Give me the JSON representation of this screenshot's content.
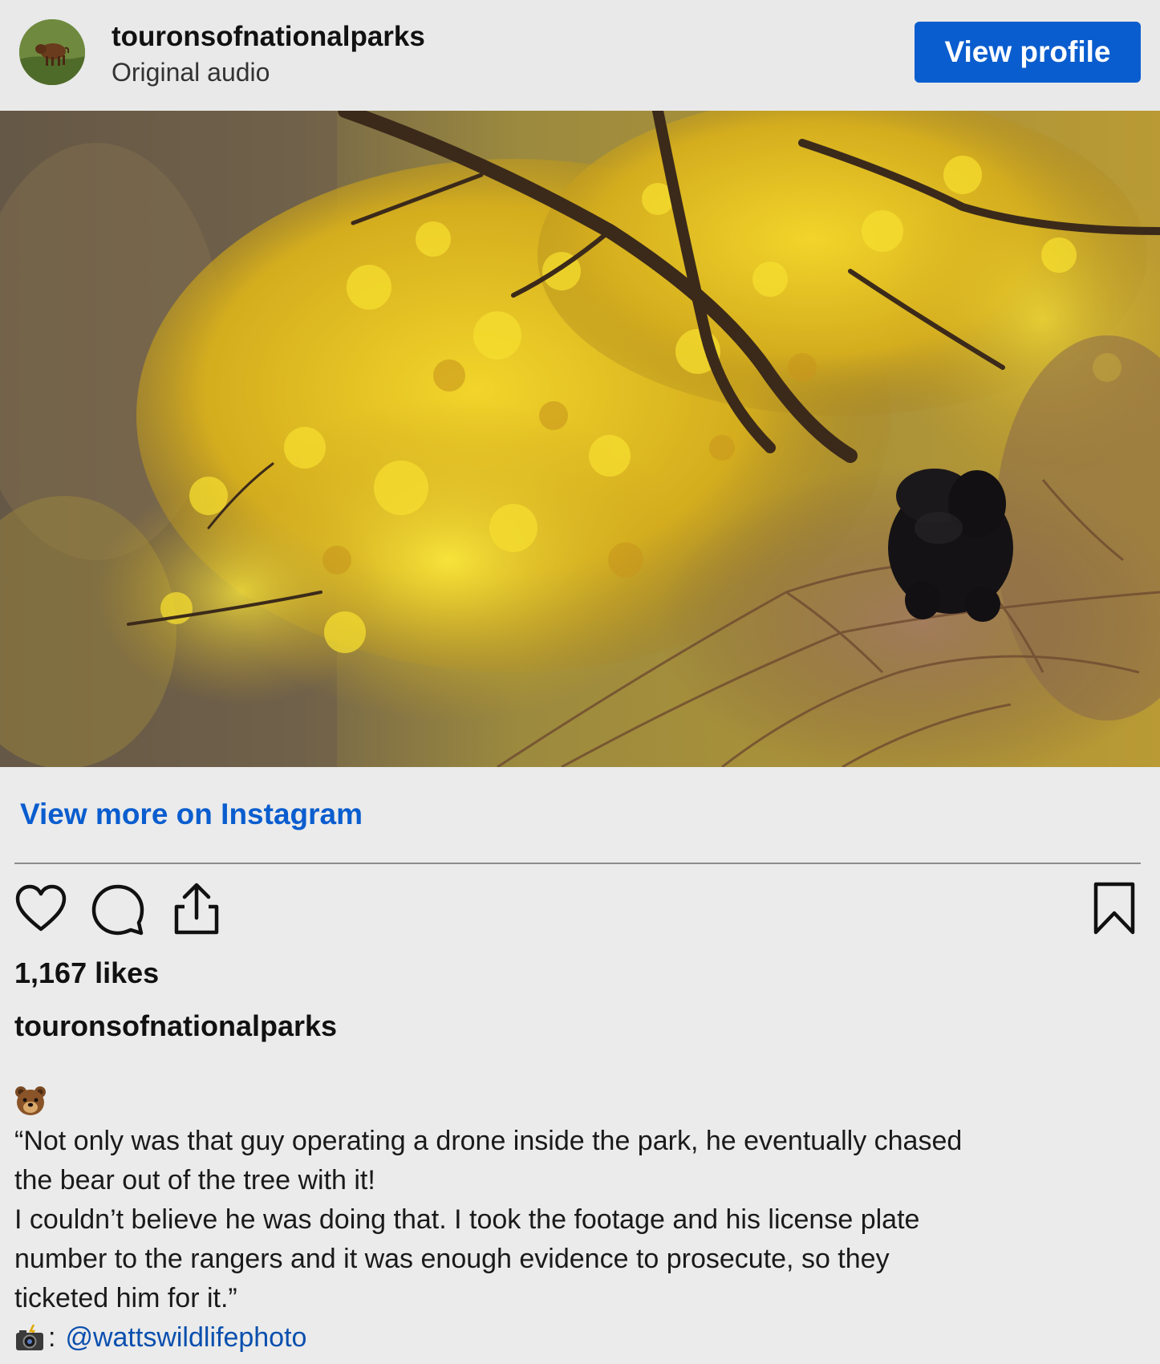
{
  "header": {
    "username": "touronsofnationalparks",
    "audio_label": "Original audio",
    "view_profile_label": "View profile"
  },
  "media": {
    "alt": "Video still: black bear in a tree with autumn yellow leaves"
  },
  "actions": {
    "view_more_label": "View more on Instagram",
    "heart_icon": "heart-icon",
    "comment_icon": "comment-icon",
    "share_icon": "share-icon",
    "bookmark_icon": "bookmark-icon"
  },
  "stats": {
    "likes_label": "1,167 likes"
  },
  "caption": {
    "username": "touronsofnationalparks",
    "emoji_icon": "bear-face-icon",
    "lines": [
      "“Not only was that guy operating a drone inside the park, he eventually chased",
      "the bear out of the tree with it!",
      "I couldn’t believe he was doing that. I took the footage and his license plate",
      "number to the rangers and it was enough evidence to prosecute, so they",
      "ticketed him for it.”"
    ],
    "credit_icon": "camera-flash-icon",
    "credit_separator": ":",
    "credit_handle": "@wattswildlifephoto"
  },
  "colors": {
    "accent_blue": "#0a5dce",
    "background": "#ebebeb"
  }
}
